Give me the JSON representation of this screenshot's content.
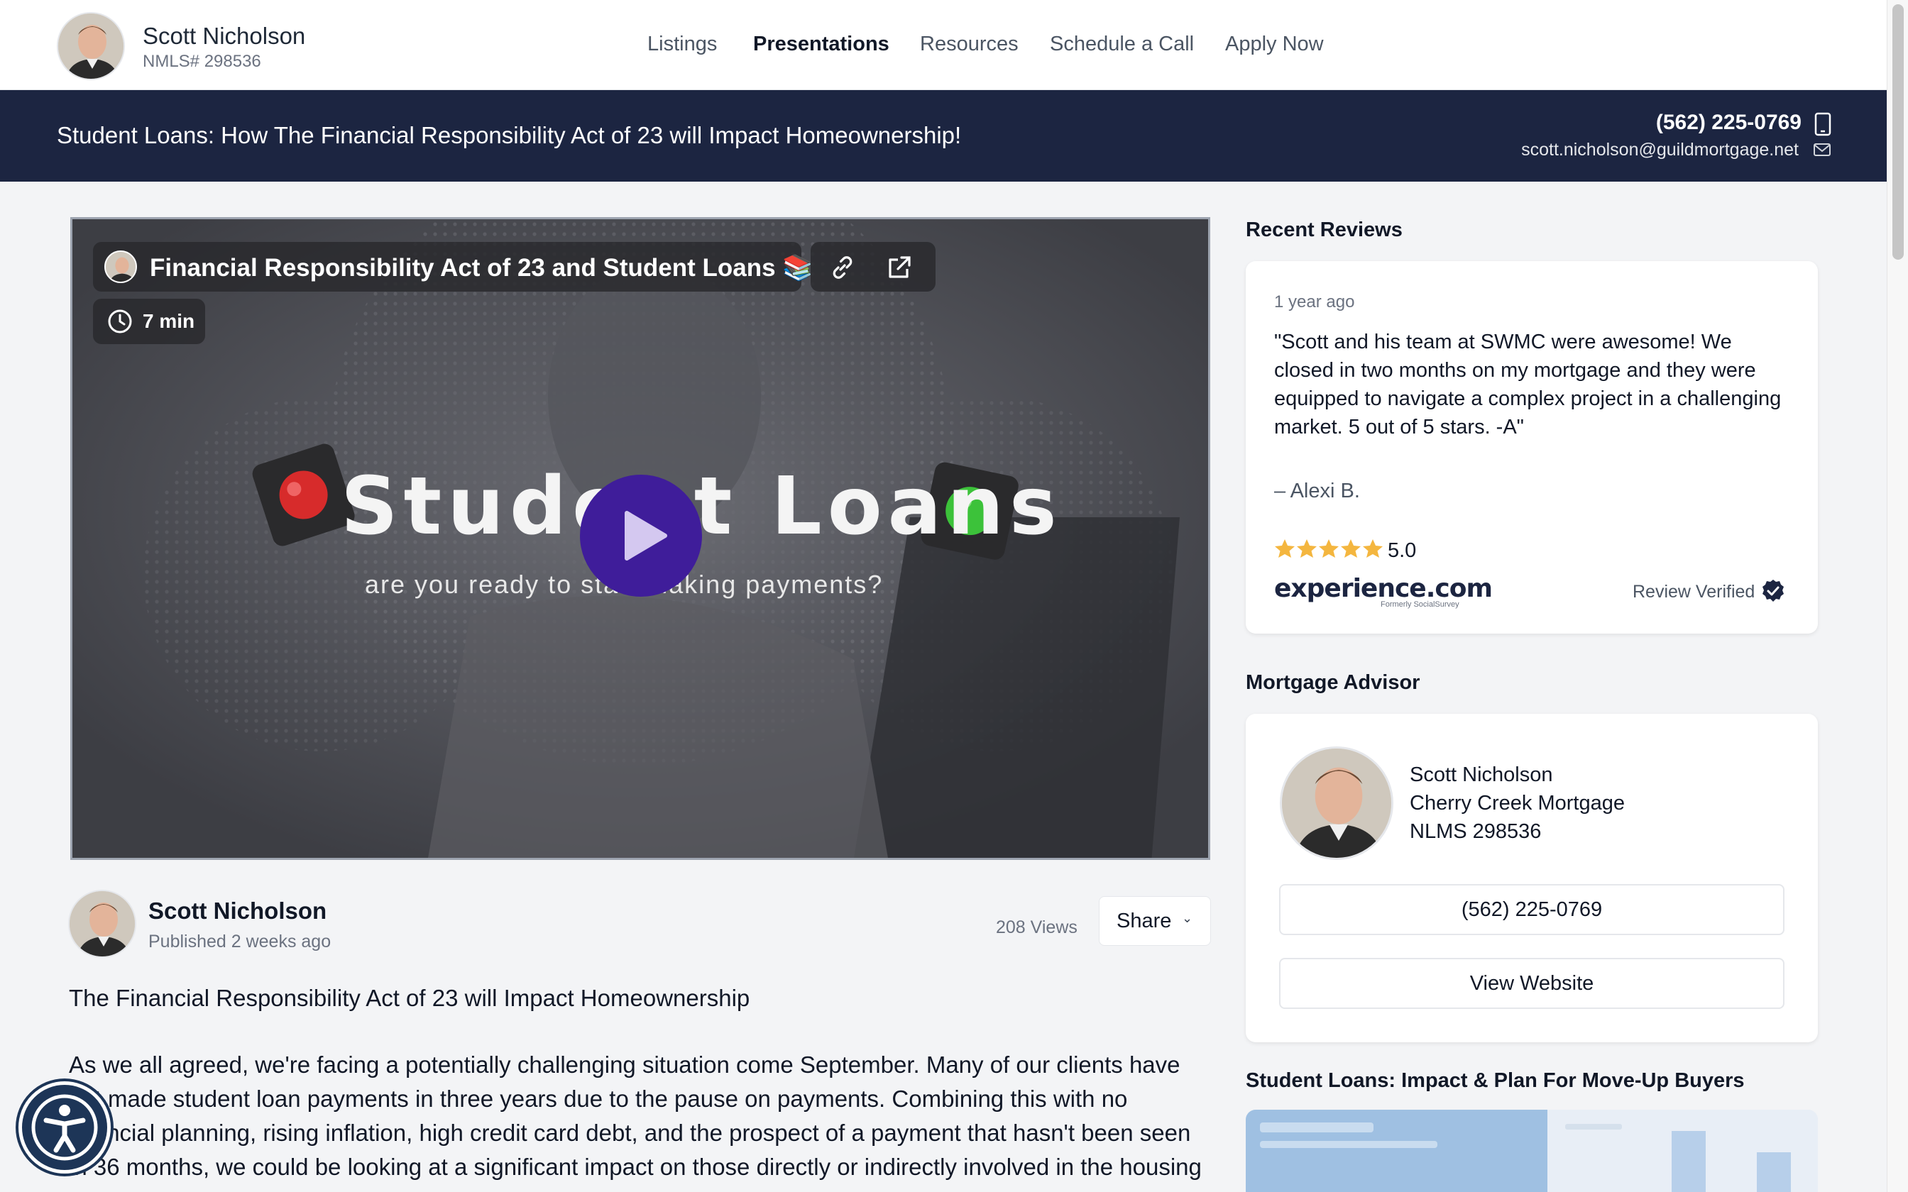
{
  "header": {
    "agent_name": "Scott Nicholson",
    "agent_nmls": "NMLS# 298536",
    "nav": [
      "Listings",
      "Presentations",
      "Resources",
      "Schedule a Call",
      "Apply Now"
    ],
    "active_nav": "Presentations"
  },
  "banner": {
    "title": "Student Loans: How The Financial Responsibility Act of 23 will Impact Homeownership!",
    "phone": "(562) 225-0769",
    "email": "scott.nicholson@guildmortgage.net"
  },
  "video": {
    "title": "Financial Responsibility Act of 23 and Student Loans 📚",
    "duration": "7 min",
    "headline": "Student Loans",
    "subtitle": "are you ready to start making payments?"
  },
  "author": {
    "name": "Scott Nicholson",
    "published": "Published 2 weeks ago",
    "views": "208 Views",
    "share_label": "Share"
  },
  "description": {
    "title": "The Financial Responsibility Act of 23 will Impact Homeownership",
    "body": "As we all agreed, we're facing a potentially challenging situation come September. Many of our clients have not made student loan payments in three years due to the pause on payments. Combining this with no financial planning, rising inflation, high credit card debt, and the prospect of a payment that hasn't been seen in 36 months, we could be looking at a significant impact on those directly or indirectly involved in the housing"
  },
  "reviews": {
    "heading": "Recent Reviews",
    "age": "1 year ago",
    "text": "\"Scott and his team at SWMC were awesome! We closed in two months on my mortgage and they were equipped to navigate a complex project in a challenging market. 5 out of 5 stars. -A\"",
    "author": "– Alexi B.",
    "rating": "5.0",
    "rating_value": 5,
    "logo_text": "experience.com",
    "logo_sub": "Formerly SocialSurvey",
    "verified_label": "Review Verified"
  },
  "advisor": {
    "heading": "Mortgage Advisor",
    "name": "Scott Nicholson",
    "company": "Cherry Creek Mortgage",
    "nmls": "NLMS 298536",
    "phone_button": "(562) 225-0769",
    "website_button": "View Website"
  },
  "related": {
    "heading": "Student Loans: Impact & Plan For Move-Up Buyers"
  },
  "colors": {
    "banner_bg": "#1c2541",
    "play_button": "#3f1d9a",
    "star": "#f4b63f",
    "verified_badge": "#1c2541"
  }
}
